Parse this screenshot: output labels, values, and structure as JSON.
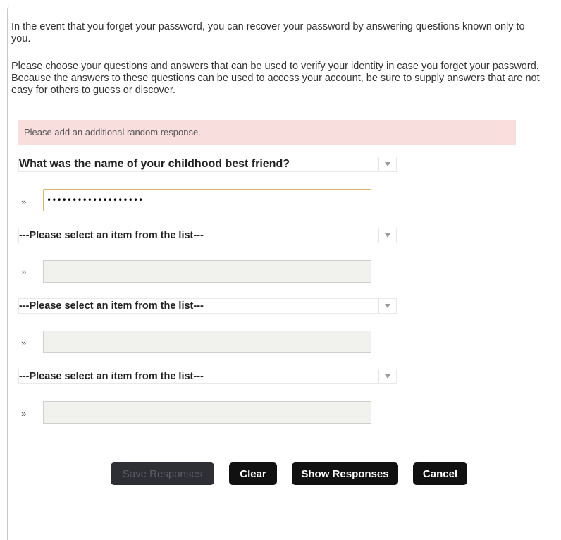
{
  "intro": {
    "paragraph1": "In the event that you forget your password, you can recover your password by answering questions known only to you.",
    "paragraph2": "Please choose your questions and answers that can be used to verify your identity in case you forget your password. Because the answers to these questions can be used to access your account, be sure to supply answers that are not easy for others to guess or discover."
  },
  "alert": {
    "message": "Please add an additional random response."
  },
  "questions": [
    {
      "selected": "What was the name of your childhood best friend?",
      "answer_value": "•••••••••••••••••••"
    },
    {
      "selected": "---Please select an item from the list---",
      "answer_value": ""
    },
    {
      "selected": "---Please select an item from the list---",
      "answer_value": ""
    },
    {
      "selected": "---Please select an item from the list---",
      "answer_value": ""
    }
  ],
  "row_marker": "»",
  "dropdown_icon": "chevron-down-icon",
  "buttons": {
    "save": "Save Responses",
    "clear": "Clear",
    "show": "Show Responses",
    "cancel": "Cancel"
  },
  "colors": {
    "alert_bg": "#f9dede",
    "button_bg": "#111111",
    "button_disabled_bg": "#2e2e35",
    "active_input_border": "#d9b46a",
    "disabled_input_bg": "#f1f1ee"
  }
}
